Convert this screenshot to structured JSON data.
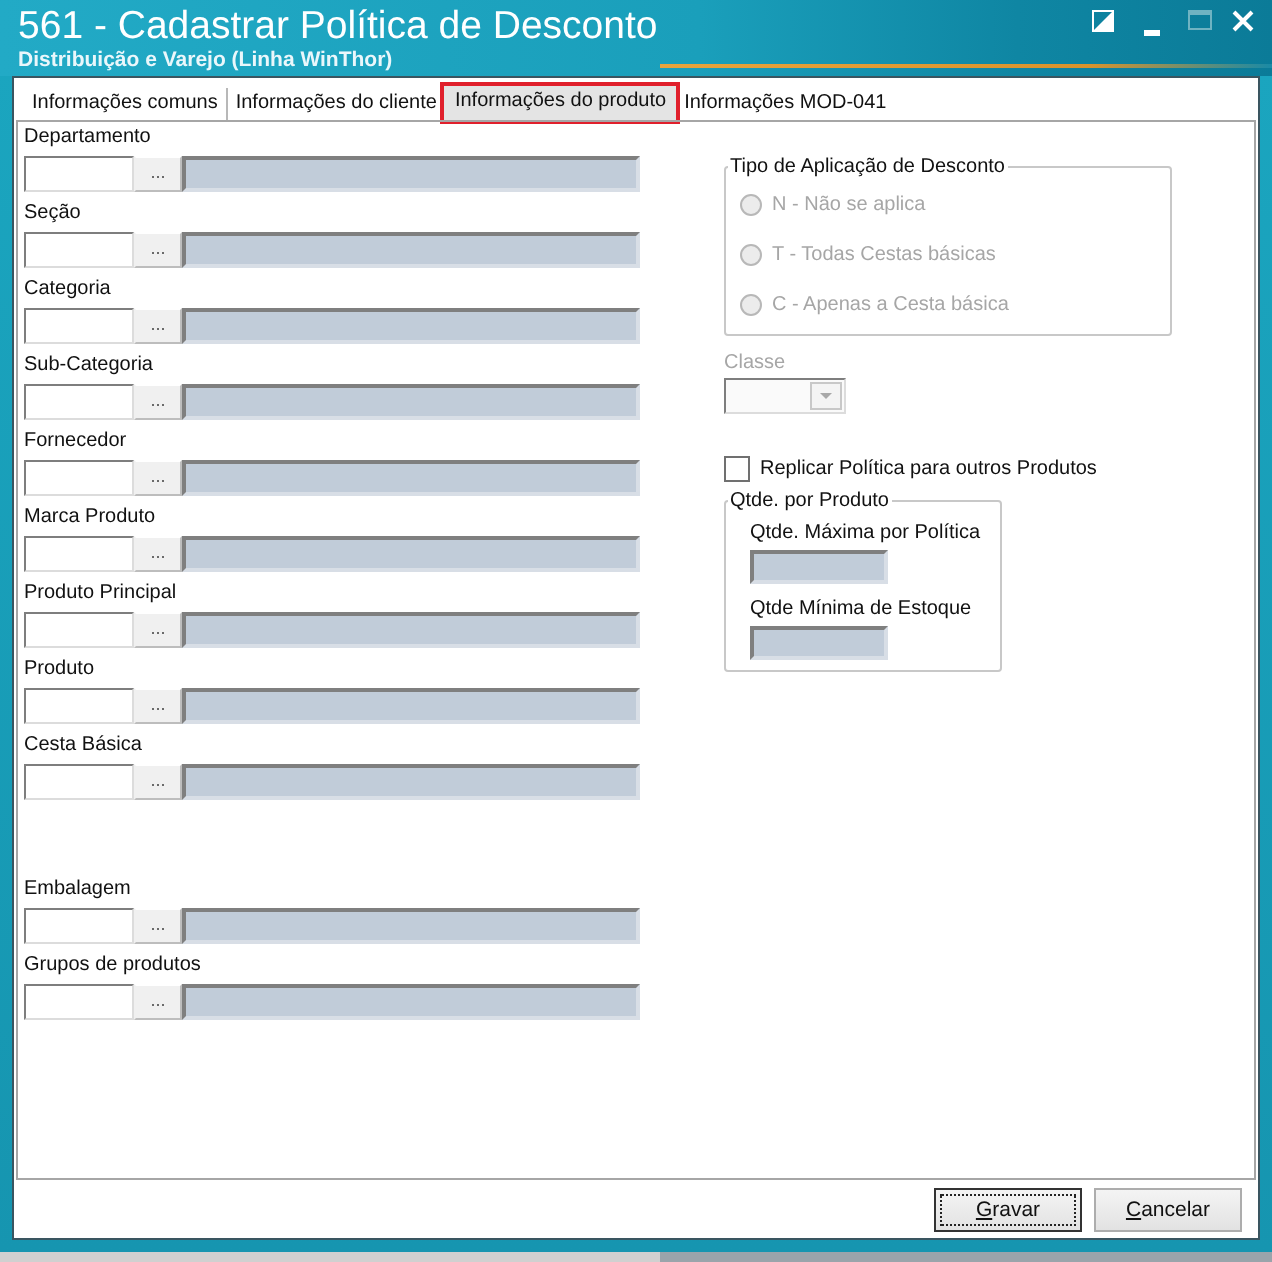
{
  "window": {
    "title": "561 - Cadastrar Política de Desconto",
    "subtitle": "Distribuição e Varejo (Linha WinThor)"
  },
  "tabs": [
    {
      "label": "Informações comuns",
      "selected": false,
      "highlighted": false
    },
    {
      "label": "Informações do cliente",
      "selected": false,
      "highlighted": false
    },
    {
      "label": "Informações do produto",
      "selected": true,
      "highlighted": true
    },
    {
      "label": "Informações MOD-041",
      "selected": false,
      "highlighted": false
    }
  ],
  "lookup_fields": [
    {
      "label": "Departamento",
      "button": "..."
    },
    {
      "label": "Seção",
      "button": "..."
    },
    {
      "label": "Categoria",
      "button": "..."
    },
    {
      "label": "Sub-Categoria",
      "button": "..."
    },
    {
      "label": "Fornecedor",
      "button": "..."
    },
    {
      "label": "Marca Produto",
      "button": "..."
    },
    {
      "label": "Produto Principal",
      "button": "..."
    },
    {
      "label": "Produto",
      "button": "..."
    },
    {
      "label": "Cesta Básica",
      "button": "..."
    }
  ],
  "lower_lookup_fields": [
    {
      "label": "Embalagem",
      "button": "..."
    },
    {
      "label": "Grupos de produtos",
      "button": "..."
    }
  ],
  "discount_type": {
    "title": "Tipo de Aplicação de Desconto",
    "disabled": true,
    "options": [
      {
        "label": "N - Não se aplica",
        "selected": false
      },
      {
        "label": "T - Todas Cestas básicas",
        "selected": false
      },
      {
        "label": "C - Apenas a Cesta básica",
        "selected": false
      }
    ]
  },
  "class_field": {
    "label": "Classe",
    "disabled": true
  },
  "replicate": {
    "label": "Replicar Política para outros Produtos",
    "checked": false
  },
  "quantity_group": {
    "title": "Qtde. por Produto",
    "fields": [
      {
        "label": "Qtde. Máxima por Política"
      },
      {
        "label": "Qtde Mínima de Estoque"
      }
    ]
  },
  "buttons": [
    {
      "label": "Gravar",
      "focused": true
    },
    {
      "label": "Cancelar",
      "focused": false
    }
  ]
}
